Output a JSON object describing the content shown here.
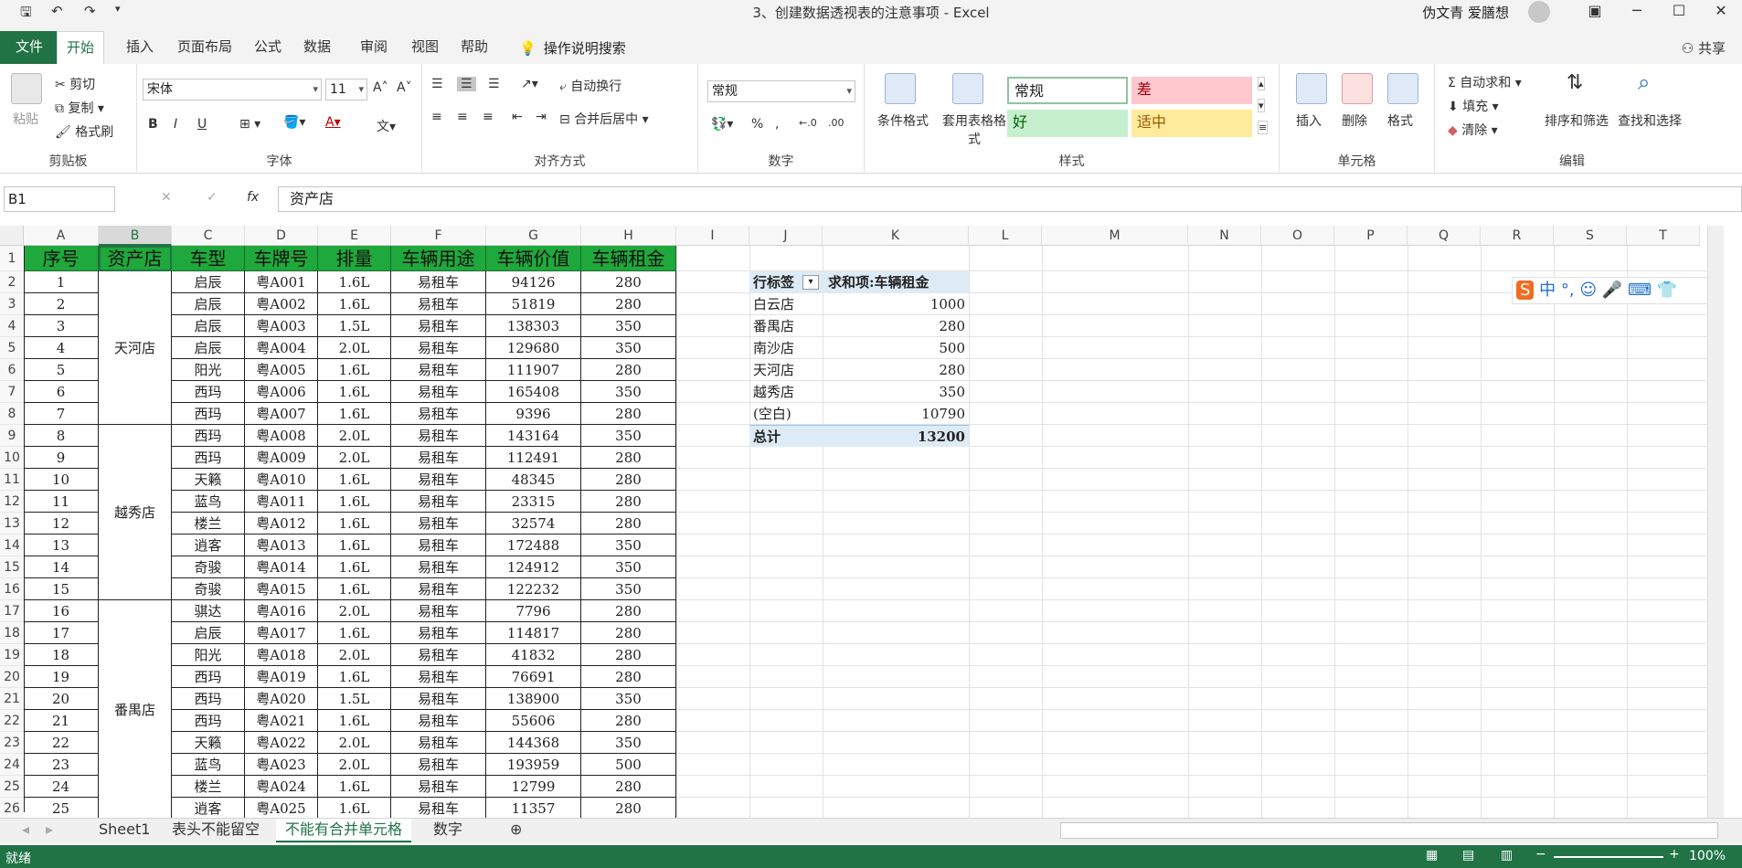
{
  "window": {
    "title": "3、创建数据透视表的注意事项  -  Excel",
    "user": "伪文青 爱膳想"
  },
  "tabs": {
    "file": "文件",
    "items": [
      "开始",
      "插入",
      "页面布局",
      "公式",
      "数据",
      "审阅",
      "视图",
      "帮助"
    ],
    "active": "开始",
    "search": "操作说明搜索",
    "share": "共享"
  },
  "ribbon": {
    "clipboard": {
      "label": "剪贴板",
      "paste": "粘贴",
      "cut": "剪切",
      "copy": "复制",
      "format_painter": "格式刷"
    },
    "font": {
      "label": "字体",
      "name": "宋体",
      "size": "11",
      "bold": "B",
      "italic": "I",
      "underline": "U"
    },
    "alignment": {
      "label": "对齐方式",
      "wrap": "自动换行",
      "merge": "合并后居中"
    },
    "number": {
      "label": "数字",
      "format": "常规"
    },
    "styles": {
      "label": "样式",
      "cond_format": "条件格式",
      "table_format": "套用表格格式",
      "normal": "常规",
      "bad": "差",
      "good": "好",
      "neutral": "适中"
    },
    "cells": {
      "label": "单元格",
      "insert": "插入",
      "delete": "删除",
      "format": "格式"
    },
    "editing": {
      "label": "编辑",
      "autosum": "自动求和",
      "fill": "填充",
      "clear": "清除",
      "sort": "排序和筛选",
      "find": "查找和选择"
    }
  },
  "formula_bar": {
    "name_box": "B1",
    "formula": "资产店"
  },
  "columns": [
    "A",
    "B",
    "C",
    "D",
    "E",
    "F",
    "G",
    "H",
    "I",
    "J",
    "K",
    "L",
    "M",
    "N",
    "O",
    "P",
    "Q",
    "R",
    "S",
    "T"
  ],
  "header_row": [
    "序号",
    "资产店",
    "车型",
    "车牌号",
    "排量",
    "车辆用途",
    "车辆价值",
    "车辆租金"
  ],
  "rows": [
    [
      "1",
      "",
      "启辰",
      "粤A001",
      "1.6L",
      "易租车",
      "94126",
      "280"
    ],
    [
      "2",
      "",
      "启辰",
      "粤A002",
      "1.6L",
      "易租车",
      "51819",
      "280"
    ],
    [
      "3",
      "",
      "启辰",
      "粤A003",
      "1.5L",
      "易租车",
      "138303",
      "350"
    ],
    [
      "4",
      "",
      "启辰",
      "粤A004",
      "2.0L",
      "易租车",
      "129680",
      "350"
    ],
    [
      "5",
      "",
      "阳光",
      "粤A005",
      "1.6L",
      "易租车",
      "111907",
      "280"
    ],
    [
      "6",
      "",
      "西玛",
      "粤A006",
      "1.6L",
      "易租车",
      "165408",
      "350"
    ],
    [
      "7",
      "",
      "西玛",
      "粤A007",
      "1.6L",
      "易租车",
      "9396",
      "280"
    ],
    [
      "8",
      "",
      "西玛",
      "粤A008",
      "2.0L",
      "易租车",
      "143164",
      "350"
    ],
    [
      "9",
      "",
      "西玛",
      "粤A009",
      "2.0L",
      "易租车",
      "112491",
      "280"
    ],
    [
      "10",
      "",
      "天籁",
      "粤A010",
      "1.6L",
      "易租车",
      "48345",
      "280"
    ],
    [
      "11",
      "",
      "蓝鸟",
      "粤A011",
      "1.6L",
      "易租车",
      "23315",
      "280"
    ],
    [
      "12",
      "",
      "楼兰",
      "粤A012",
      "1.6L",
      "易租车",
      "32574",
      "280"
    ],
    [
      "13",
      "",
      "逍客",
      "粤A013",
      "1.6L",
      "易租车",
      "172488",
      "350"
    ],
    [
      "14",
      "",
      "奇骏",
      "粤A014",
      "1.6L",
      "易租车",
      "124912",
      "350"
    ],
    [
      "15",
      "",
      "奇骏",
      "粤A015",
      "1.6L",
      "易租车",
      "122232",
      "350"
    ],
    [
      "16",
      "",
      "骐达",
      "粤A016",
      "2.0L",
      "易租车",
      "7796",
      "280"
    ],
    [
      "17",
      "",
      "启辰",
      "粤A017",
      "1.6L",
      "易租车",
      "114817",
      "280"
    ],
    [
      "18",
      "",
      "阳光",
      "粤A018",
      "2.0L",
      "易租车",
      "41832",
      "280"
    ],
    [
      "19",
      "",
      "西玛",
      "粤A019",
      "1.6L",
      "易租车",
      "76691",
      "280"
    ],
    [
      "20",
      "",
      "西玛",
      "粤A020",
      "1.5L",
      "易租车",
      "138900",
      "350"
    ],
    [
      "21",
      "",
      "西玛",
      "粤A021",
      "1.6L",
      "易租车",
      "55606",
      "280"
    ],
    [
      "22",
      "",
      "天籁",
      "粤A022",
      "2.0L",
      "易租车",
      "144368",
      "350"
    ],
    [
      "23",
      "",
      "蓝鸟",
      "粤A023",
      "2.0L",
      "易租车",
      "193959",
      "500"
    ],
    [
      "24",
      "",
      "楼兰",
      "粤A024",
      "1.6L",
      "易租车",
      "12799",
      "280"
    ],
    [
      "25",
      "",
      "逍客",
      "粤A025",
      "1.6L",
      "易租车",
      "11357",
      "280"
    ]
  ],
  "merged_stores": [
    {
      "name": "天河店",
      "from": 0,
      "to": 6
    },
    {
      "name": "越秀店",
      "from": 7,
      "to": 14
    },
    {
      "name": "番禺店",
      "from": 15,
      "to": 24
    }
  ],
  "pivot": {
    "row_label": "行标签",
    "value_label": "求和项:车辆租金",
    "rows": [
      [
        "白云店",
        "1000"
      ],
      [
        "番禺店",
        "280"
      ],
      [
        "南沙店",
        "500"
      ],
      [
        "天河店",
        "280"
      ],
      [
        "越秀店",
        "350"
      ],
      [
        "(空白)",
        "10790"
      ]
    ],
    "total_label": "总计",
    "total": "13200"
  },
  "sheet_tabs": [
    "Sheet1",
    "表头不能留空",
    "不能有合并单元格",
    "数字"
  ],
  "active_sheet": "不能有合并单元格",
  "status": {
    "ready": "就绪",
    "zoom": "100%"
  },
  "colors": {
    "accent": "#217346",
    "header_fill": "#1fa83c"
  }
}
